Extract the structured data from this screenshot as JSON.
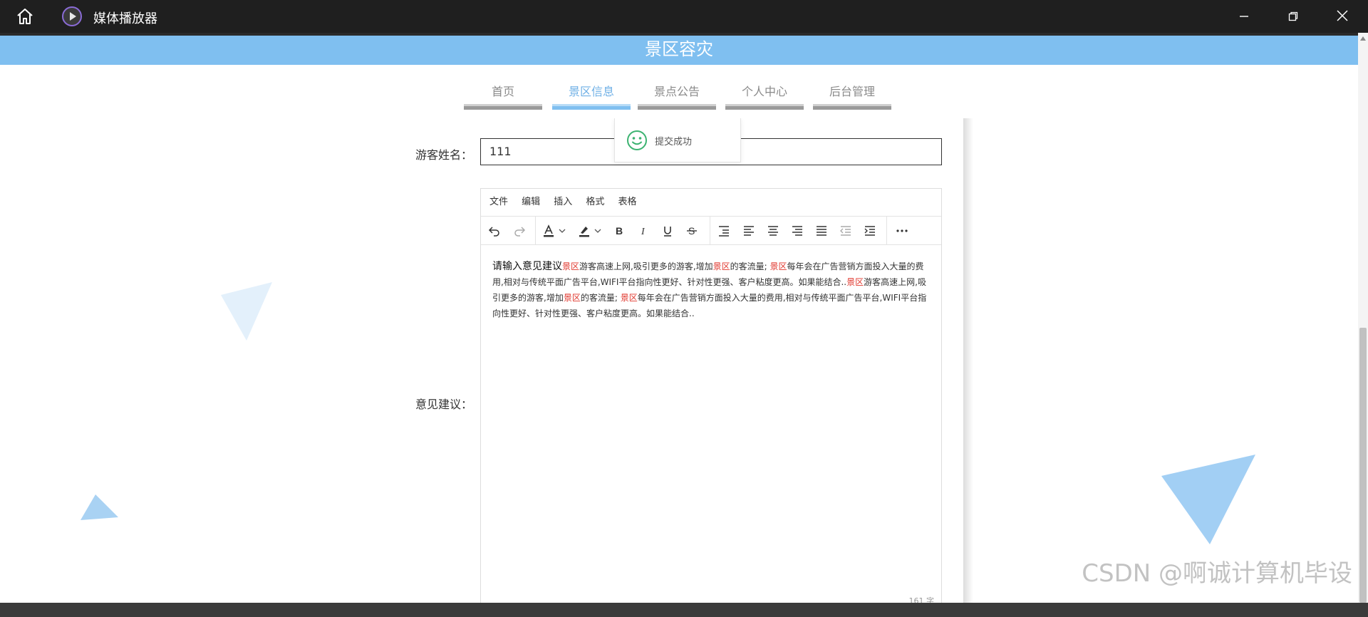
{
  "window": {
    "title": "媒体播放器"
  },
  "site": {
    "banner": "景区容灾",
    "nav": [
      {
        "label": "首页",
        "active": false
      },
      {
        "label": "景区信息",
        "active": true
      },
      {
        "label": "景点公告",
        "active": false
      },
      {
        "label": "个人中心",
        "active": false
      },
      {
        "label": "后台管理",
        "active": false
      }
    ]
  },
  "toast": {
    "message": "提交成功"
  },
  "form": {
    "name_label": "游客姓名：",
    "name_value": "111",
    "feedback_label": "意见建议："
  },
  "editor": {
    "menus": [
      "文件",
      "编辑",
      "插入",
      "格式",
      "表格"
    ],
    "word_count": "161 字",
    "content": [
      {
        "text": "请输入意见建议",
        "style": "lead"
      },
      {
        "text": "景区",
        "style": "hl"
      },
      {
        "text": "游客高速上网,吸引更多的游客,增加",
        "style": ""
      },
      {
        "text": "景区",
        "style": "hl"
      },
      {
        "text": "的客流量; ",
        "style": ""
      },
      {
        "text": "景区",
        "style": "hl"
      },
      {
        "text": "每年会在广告营销方面投入大量的费用,相对与传统平面广告平台,WIFI平台指向性更好、针对性更强、客户粘度更高。如果能结合..",
        "style": ""
      },
      {
        "text": "景区",
        "style": "hl"
      },
      {
        "text": "游客高速上网,吸引更多的游客,增加",
        "style": ""
      },
      {
        "text": "景区",
        "style": "hl"
      },
      {
        "text": "的客流量; ",
        "style": ""
      },
      {
        "text": "景区",
        "style": "hl"
      },
      {
        "text": "每年会在广告营销方面投入大量的费用,相对与传统平面广告平台,WIFI平台指向性更好、针对性更强、客户粘度更高。如果能结合..",
        "style": ""
      }
    ]
  },
  "watermark": "CSDN @啊诚计算机毕设",
  "colors": {
    "banner": "#7fbff0",
    "highlight": "#e0362c",
    "accent": "#6fb0e6"
  }
}
